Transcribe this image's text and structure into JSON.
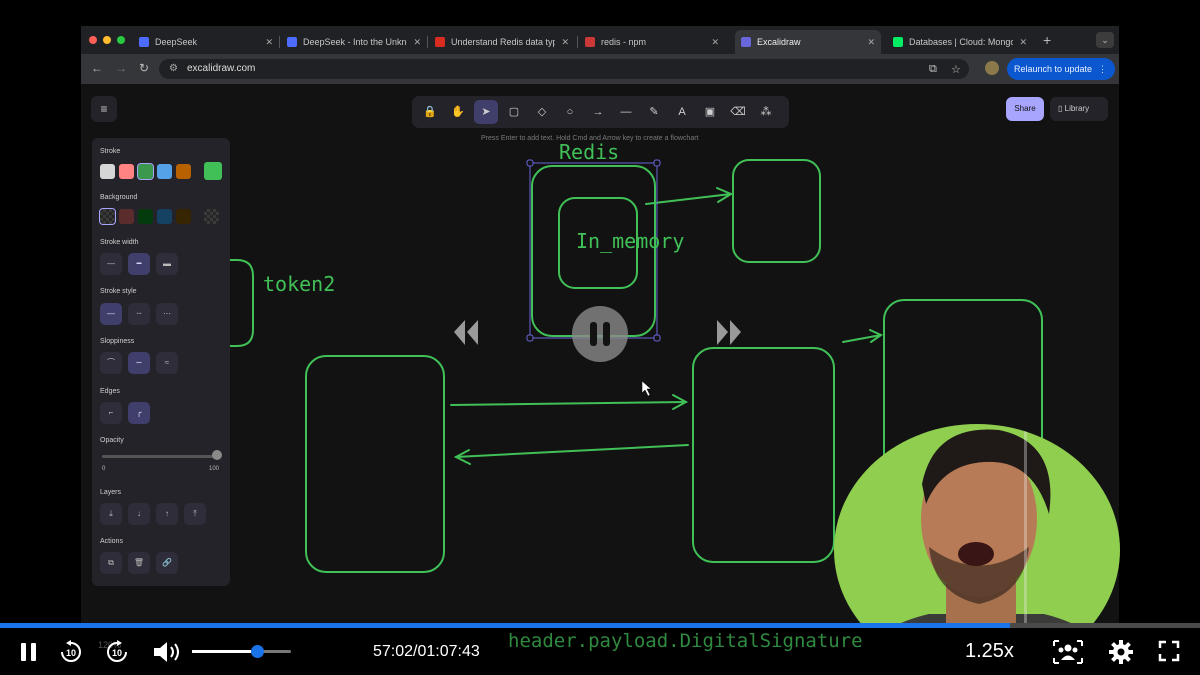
{
  "browser": {
    "tabs": [
      {
        "label": "DeepSeek",
        "favicon_color": "#4d6bfe"
      },
      {
        "label": "DeepSeek - Into the Unkno",
        "favicon_color": "#4d6bfe"
      },
      {
        "label": "Understand Redis data typ",
        "favicon_color": "#d82c20"
      },
      {
        "label": "redis - npm",
        "favicon_color": "#cb3837"
      },
      {
        "label": "Excalidraw",
        "favicon_color": "#6965db"
      },
      {
        "label": "Databases | Cloud: Mongo",
        "favicon_color": "#00ed64"
      }
    ],
    "active_tab": 4,
    "url": "excalidraw.com",
    "relaunch_label": "Relaunch to update"
  },
  "excalidraw": {
    "hint": "Press Enter to add text. Hold Cmd and Arrow key to create a flowchart",
    "share_label": "Share",
    "library_label": "Library",
    "tools": [
      {
        "icon": "lock-icon",
        "glyph": "🔒"
      },
      {
        "icon": "hand-icon",
        "glyph": "✋"
      },
      {
        "icon": "selection-icon",
        "glyph": "➤"
      },
      {
        "icon": "rectangle-icon",
        "glyph": "▢"
      },
      {
        "icon": "diamond-icon",
        "glyph": "◇"
      },
      {
        "icon": "ellipse-icon",
        "glyph": "○"
      },
      {
        "icon": "arrow-icon",
        "glyph": "→"
      },
      {
        "icon": "line-icon",
        "glyph": "—"
      },
      {
        "icon": "pencil-icon",
        "glyph": "✎"
      },
      {
        "icon": "text-icon",
        "glyph": "A"
      },
      {
        "icon": "image-icon",
        "glyph": "▣"
      },
      {
        "icon": "eraser-icon",
        "glyph": "⌫"
      },
      {
        "icon": "more-tools-icon",
        "glyph": "⁂"
      }
    ],
    "selected_tool": 2,
    "panel": {
      "stroke_label": "Stroke",
      "stroke_colors": [
        "#d6d6d6",
        "#ff8383",
        "#3a994c",
        "#56a2e8",
        "#b76100"
      ],
      "stroke_current": "#40c057",
      "background_label": "Background",
      "background_colors": [
        "transparent",
        "#5b2c2c",
        "#043b0c",
        "#154163",
        "#362500",
        "transparent"
      ],
      "stroke_width_label": "Stroke width",
      "stroke_style_label": "Stroke style",
      "sloppiness_label": "Sloppiness",
      "edges_label": "Edges",
      "opacity_label": "Opacity",
      "opacity_min": "0",
      "opacity_max": "100",
      "opacity_value": 100,
      "layers_label": "Layers",
      "actions_label": "Actions"
    },
    "canvas_text": {
      "redis": "Redis",
      "in_memory": "In_memory",
      "token2": "token2"
    }
  },
  "player": {
    "current_time": "57:02",
    "duration": "01:07:43",
    "time_display": "57:02/01:07:43",
    "speed": "1.25x",
    "progress_fraction": 0.842,
    "volume_fraction": 0.6,
    "under_text": "header.payload.DigitalSignature",
    "under_zoom": "120%"
  }
}
